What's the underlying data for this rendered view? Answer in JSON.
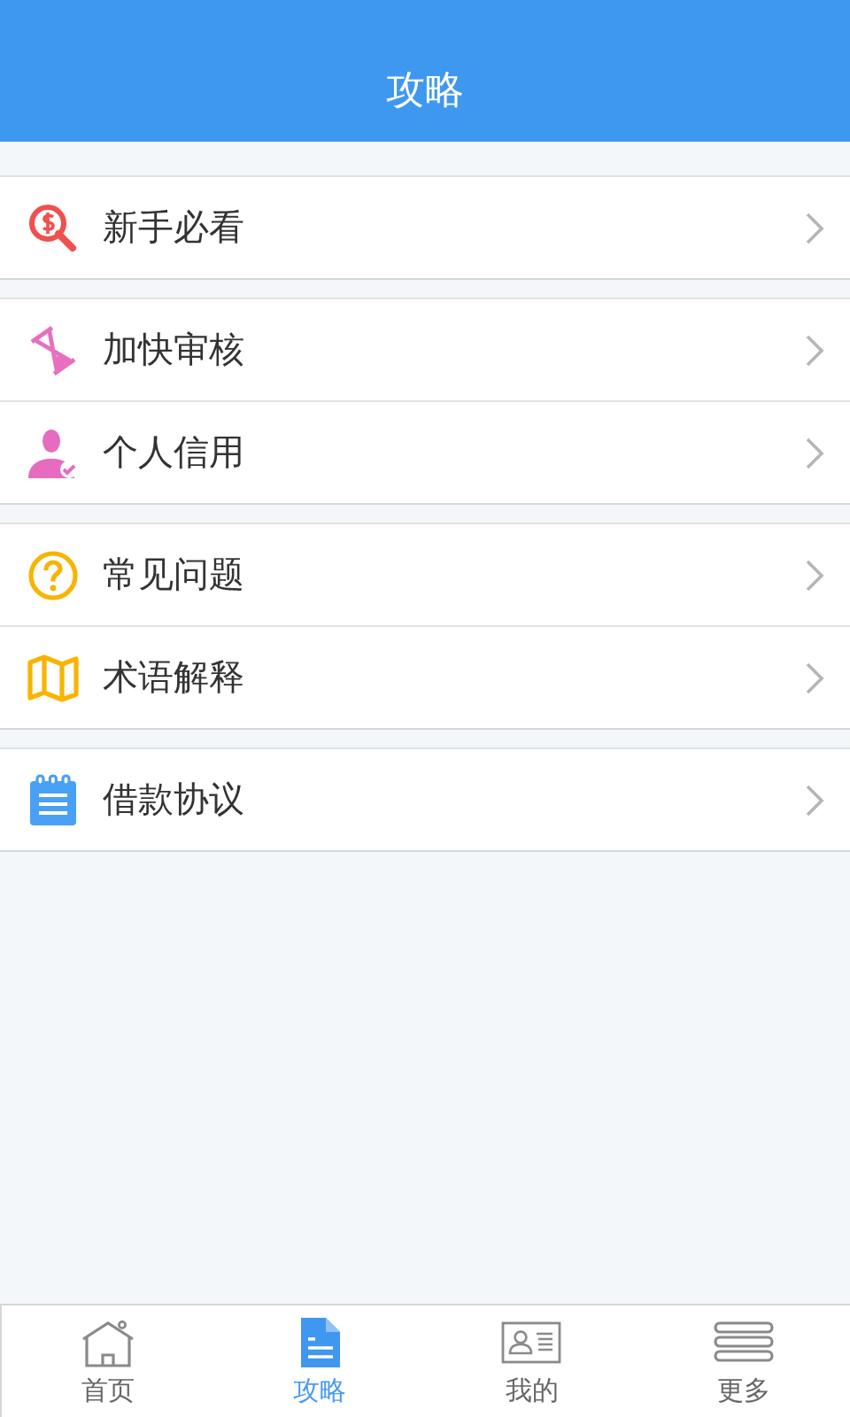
{
  "header": {
    "title": "攻略"
  },
  "groups": [
    {
      "items": [
        {
          "label": "新手必看"
        }
      ]
    },
    {
      "items": [
        {
          "label": "加快审核"
        },
        {
          "label": "个人信用"
        }
      ]
    },
    {
      "items": [
        {
          "label": "常见问题"
        },
        {
          "label": "术语解释"
        }
      ]
    },
    {
      "items": [
        {
          "label": "借款协议"
        }
      ]
    }
  ],
  "tabs": [
    {
      "label": "首页",
      "selected": false
    },
    {
      "label": "攻略",
      "selected": true
    },
    {
      "label": "我的",
      "selected": false
    },
    {
      "label": "更多",
      "selected": false
    }
  ]
}
